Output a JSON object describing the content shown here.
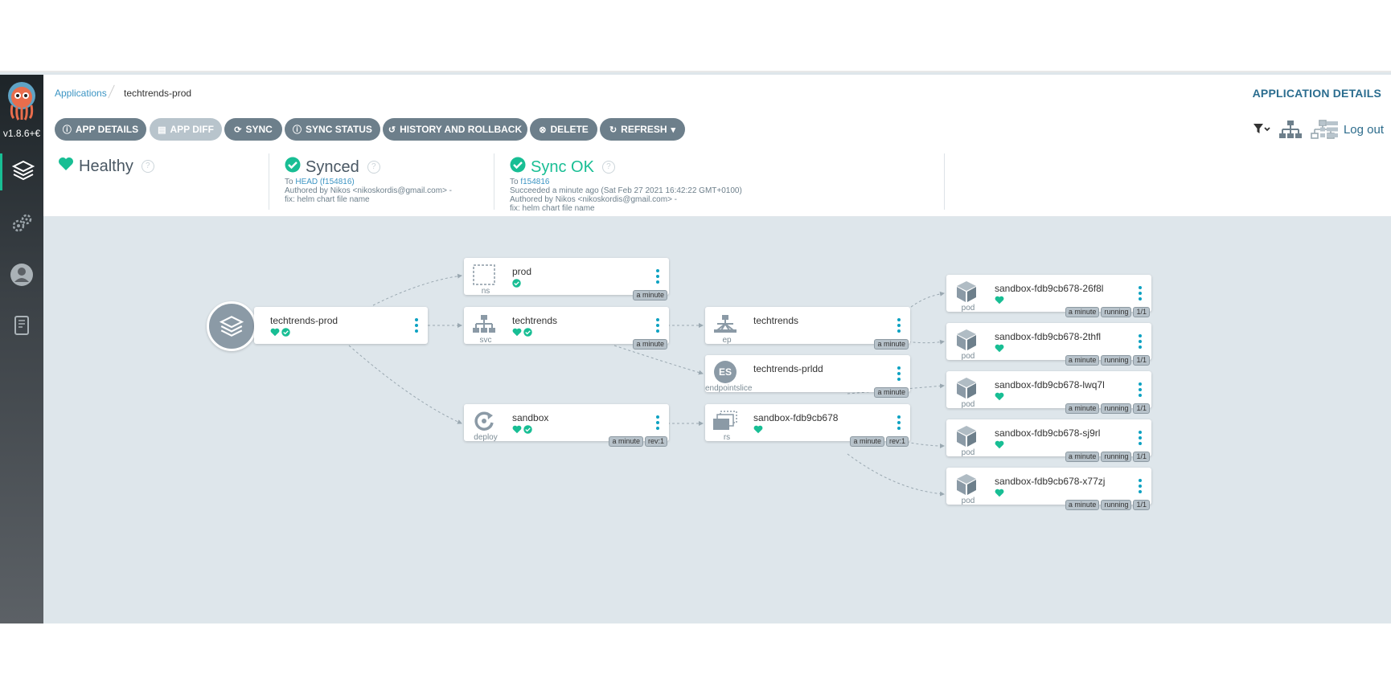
{
  "app": {
    "version": "v1.8.6+€"
  },
  "breadcrumb": {
    "root": "Applications",
    "current": "techtrends-prod"
  },
  "header": {
    "title": "APPLICATION DETAILS"
  },
  "toolbar": {
    "app_details": "APP DETAILS",
    "app_diff": "APP DIFF",
    "sync": "SYNC",
    "sync_status": "SYNC STATUS",
    "history": "HISTORY AND ROLLBACK",
    "delete": "DELETE",
    "refresh": "REFRESH",
    "logout": "Log out"
  },
  "status": {
    "health": {
      "label": "Healthy"
    },
    "sync": {
      "label": "Synced",
      "to_prefix": "To",
      "to_ref": "HEAD (f154816)",
      "author": "Authored by Nikos <nikoskordis@gmail.com> -",
      "message": "fix: helm chart file name"
    },
    "operation": {
      "label": "Sync OK",
      "to_prefix": "To",
      "to_ref": "f154816",
      "succeeded": "Succeeded a minute ago (Sat Feb 27 2021 16:42:22 GMT+0100)",
      "author": "Authored by Nikos <nikoskordis@gmail.com> -",
      "message": "fix: helm chart file name"
    }
  },
  "colors": {
    "healthy": "#18be94",
    "accent": "#0da2c2",
    "button": "#6d7f8b"
  },
  "nodes": {
    "app": {
      "name": "techtrends-prod"
    },
    "ns": {
      "name": "prod",
      "kind": "ns",
      "age": "a minute"
    },
    "svc": {
      "name": "techtrends",
      "kind": "svc",
      "age": "a minute"
    },
    "deploy": {
      "name": "sandbox",
      "kind": "deploy",
      "age": "a minute",
      "rev": "rev:1"
    },
    "ep": {
      "name": "techtrends",
      "kind": "ep",
      "age": "a minute"
    },
    "eps": {
      "name": "techtrends-prldd",
      "kind": "endpointslice",
      "icon_text": "ES",
      "age": "a minute"
    },
    "rs": {
      "name": "sandbox-fdb9cb678",
      "kind": "rs",
      "age": "a minute",
      "rev": "rev:1"
    },
    "pods": [
      {
        "name": "sandbox-fdb9cb678-26f8l",
        "kind": "pod",
        "age": "a minute",
        "phase": "running",
        "ready": "1/1"
      },
      {
        "name": "sandbox-fdb9cb678-2thfl",
        "kind": "pod",
        "age": "a minute",
        "phase": "running",
        "ready": "1/1"
      },
      {
        "name": "sandbox-fdb9cb678-lwq7l",
        "kind": "pod",
        "age": "a minute",
        "phase": "running",
        "ready": "1/1"
      },
      {
        "name": "sandbox-fdb9cb678-sj9rl",
        "kind": "pod",
        "age": "a minute",
        "phase": "running",
        "ready": "1/1"
      },
      {
        "name": "sandbox-fdb9cb678-x77zj",
        "kind": "pod",
        "age": "a minute",
        "phase": "running",
        "ready": "1/1"
      }
    ]
  }
}
